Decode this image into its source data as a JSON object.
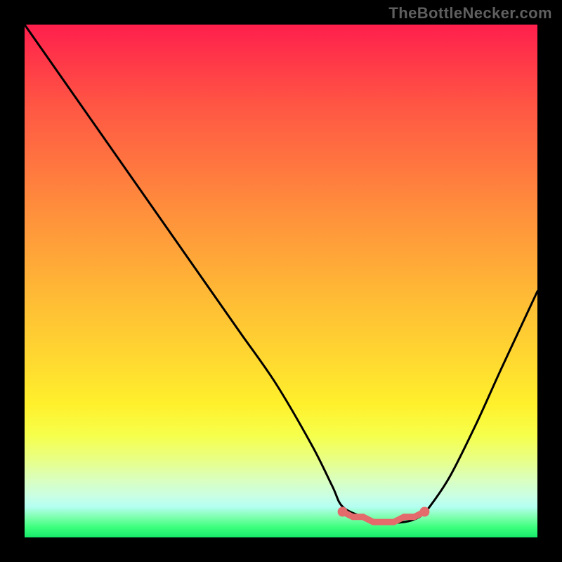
{
  "watermark": "TheBottleNecker.com",
  "chart_data": {
    "type": "line",
    "title": "",
    "xlabel": "",
    "ylabel": "",
    "xlim": [
      0,
      100
    ],
    "ylim": [
      0,
      100
    ],
    "series": [
      {
        "name": "bottleneck-curve",
        "x": [
          0,
          7,
          14,
          21,
          28,
          35,
          42,
          49,
          56,
          60,
          62,
          66,
          70,
          74,
          77,
          79,
          83,
          88,
          93,
          100
        ],
        "values": [
          100,
          90,
          80,
          70,
          60,
          50,
          40,
          30,
          18,
          10,
          6,
          4,
          3,
          3,
          4,
          6,
          12,
          22,
          33,
          48
        ]
      },
      {
        "name": "sweet-spot-band",
        "x": [
          62,
          64,
          66,
          68,
          70,
          72,
          74,
          76,
          78
        ],
        "values": [
          5,
          4,
          4,
          3,
          3,
          3,
          4,
          4,
          5
        ]
      }
    ],
    "colors": {
      "curve": "#000000",
      "sweet_spot": "#e46b6b",
      "gradient_top": "#ff1f4d",
      "gradient_bottom": "#17e86a"
    }
  }
}
